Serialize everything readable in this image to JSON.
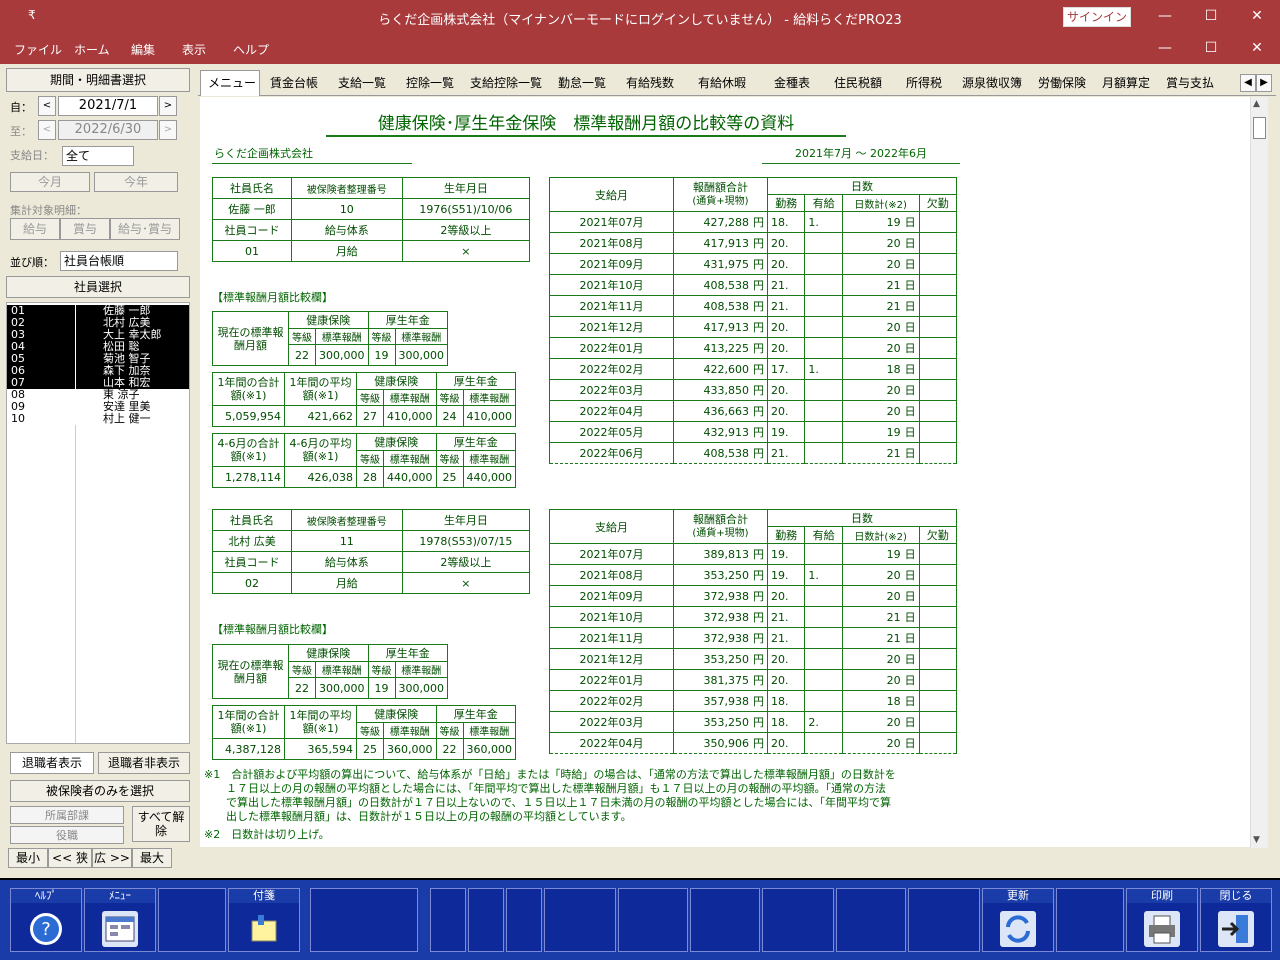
{
  "window": {
    "title": "らくだ企画株式会社（マイナンバーモードにログインしていません） - 給料らくだPRO23",
    "signin": "サインイン",
    "min": "—",
    "max": "☐",
    "close": "✕"
  },
  "menu": [
    "ファイル",
    "ホーム",
    "編集",
    "表示",
    "ヘルプ"
  ],
  "left": {
    "period_btn": "期間・明細書選択",
    "from_lbl": "自：",
    "from": "2021/7/1",
    "to_lbl": "至：",
    "to": "2022/6/30",
    "paydate_lbl": "支給日：",
    "paydate": "全て",
    "this_month": "今月",
    "this_year": "今年",
    "target_lbl": "集計対象明細：",
    "t1": "給与",
    "t2": "賞与",
    "t3": "給与･賞与",
    "sort_lbl": "並び順：",
    "sort": "社員台帳順",
    "emp_sel": "社員選択",
    "employees": [
      {
        "code": "01",
        "name": "佐藤 一郎"
      },
      {
        "code": "02",
        "name": "北村 広美"
      },
      {
        "code": "03",
        "name": "大上 幸太郎"
      },
      {
        "code": "04",
        "name": "松田 聡"
      },
      {
        "code": "05",
        "name": "菊池 智子"
      },
      {
        "code": "06",
        "name": "森下 加奈"
      },
      {
        "code": "07",
        "name": "山本 和宏"
      },
      {
        "code": "08",
        "name": "東 涼子"
      },
      {
        "code": "09",
        "name": "安達 里美"
      },
      {
        "code": "10",
        "name": "村上 健一"
      }
    ],
    "retired_show": "退職者表示",
    "retired_hide": "退職者非表示",
    "insured_only": "被保険者のみを選択",
    "dept": "所属部課",
    "role": "役職",
    "clear_all": "すべて解除",
    "min": "最小",
    "narrow": "<< 狭",
    "wide": "広 >>",
    "max": "最大"
  },
  "tabs": [
    "メニュー",
    "賃金台帳",
    "支給一覧",
    "控除一覧",
    "支給控除一覧",
    "勤怠一覧",
    "有給残数",
    "有給休暇",
    "金種表",
    "住民税額",
    "所得税",
    "源泉徴収簿",
    "労働保険",
    "月額算定",
    "賞与支払"
  ],
  "doc": {
    "title": "健康保険･厚生年金保険　標準報酬月額の比較等の資料",
    "company": "らくだ企画株式会社",
    "period": "2021年7月 〜 2022年6月",
    "hdr": {
      "name": "社員氏名",
      "insno": "被保険者整理番号",
      "birth": "生年月日",
      "code": "社員コード",
      "paytype": "給与体系",
      "grade2": "2等級以上",
      "section": "【標準報酬月額比較欄】",
      "current": "現在の標準報酬月額",
      "health": "健康保険",
      "pension": "厚生年金",
      "grade": "等級",
      "std": "標準報酬",
      "year_total": "1年間の合計額(※1)",
      "year_avg": "1年間の平均額(※1)",
      "q_total": "4-6月の合計額(※1)",
      "q_avg": "4-6月の平均額(※1)",
      "paymonth": "支給月",
      "remun": "報酬額合計",
      "remun2": "(通貨+現物)",
      "days": "日数",
      "work": "勤務",
      "paid": "有給",
      "daysum": "日数計(※2)",
      "absent": "欠勤",
      "yen": "円",
      "day": "日"
    },
    "p1": {
      "name": "佐藤 一郎",
      "insno": "10",
      "birth": "1976(S51)/10/06",
      "code": "01",
      "paytype": "月給",
      "grade2": "×",
      "cur_hg": "22",
      "cur_hs": "300,000",
      "cur_pg": "19",
      "cur_ps": "300,000",
      "yt": "5,059,954",
      "ya": "421,662",
      "y_hg": "27",
      "y_hs": "410,000",
      "y_pg": "24",
      "y_ps": "410,000",
      "qt": "1,278,114",
      "qa": "426,038",
      "q_hg": "28",
      "q_hs": "440,000",
      "q_pg": "25",
      "q_ps": "440,000",
      "rows": [
        [
          "2021年07月",
          "427,288",
          "18.",
          "1.",
          "19"
        ],
        [
          "2021年08月",
          "417,913",
          "20.",
          "",
          "20"
        ],
        [
          "2021年09月",
          "431,975",
          "20.",
          "",
          "20"
        ],
        [
          "2021年10月",
          "408,538",
          "21.",
          "",
          "21"
        ],
        [
          "2021年11月",
          "408,538",
          "21.",
          "",
          "21"
        ],
        [
          "2021年12月",
          "417,913",
          "20.",
          "",
          "20"
        ],
        [
          "2022年01月",
          "413,225",
          "20.",
          "",
          "20"
        ],
        [
          "2022年02月",
          "422,600",
          "17.",
          "1.",
          "18"
        ],
        [
          "2022年03月",
          "433,850",
          "20.",
          "",
          "20"
        ],
        [
          "2022年04月",
          "436,663",
          "20.",
          "",
          "20"
        ],
        [
          "2022年05月",
          "432,913",
          "19.",
          "",
          "19"
        ],
        [
          "2022年06月",
          "408,538",
          "21.",
          "",
          "21"
        ]
      ]
    },
    "p2": {
      "name": "北村 広美",
      "insno": "11",
      "birth": "1978(S53)/07/15",
      "code": "02",
      "paytype": "月給",
      "grade2": "×",
      "cur_hg": "22",
      "cur_hs": "300,000",
      "cur_pg": "19",
      "cur_ps": "300,000",
      "yt": "4,387,128",
      "ya": "365,594",
      "y_hg": "25",
      "y_hs": "360,000",
      "y_pg": "22",
      "y_ps": "360,000",
      "rows": [
        [
          "2021年07月",
          "389,813",
          "19.",
          "",
          "19"
        ],
        [
          "2021年08月",
          "353,250",
          "19.",
          "1.",
          "20"
        ],
        [
          "2021年09月",
          "372,938",
          "20.",
          "",
          "20"
        ],
        [
          "2021年10月",
          "372,938",
          "21.",
          "",
          "21"
        ],
        [
          "2021年11月",
          "372,938",
          "21.",
          "",
          "21"
        ],
        [
          "2021年12月",
          "353,250",
          "20.",
          "",
          "20"
        ],
        [
          "2022年01月",
          "381,375",
          "20.",
          "",
          "20"
        ],
        [
          "2022年02月",
          "357,938",
          "18.",
          "",
          "18"
        ],
        [
          "2022年03月",
          "353,250",
          "18.",
          "2.",
          "20"
        ],
        [
          "2022年04月",
          "350,906",
          "20.",
          "",
          "20"
        ]
      ]
    },
    "note1": [
      "※1　合計額および平均額の算出について、給与体系が「日給」または「時給」の場合は、「通常の方法で算出した標準報酬月額」の日数計を",
      "　　１７日以上の月の報酬の平均額とした場合には、「年間平均で算出した標準報酬月額」も１７日以上の月の報酬の平均額。「通常の方法",
      "　　で算出した標準報酬月額」の日数計が１７日以上ないので、１５日以上１７日未満の月の報酬の平均額とした場合には、「年間平均で算",
      "　　出した標準報酬月額」は、日数計が１５日以上の月の報酬の平均額としています。"
    ],
    "note2": "※2　日数計は切り上げ。"
  },
  "footer": {
    "help": "ﾍﾙﾌﾟ",
    "menu": "ﾒﾆｭｰ",
    "tag": "付箋",
    "refresh": "更新",
    "print": "印刷",
    "close": "閉じる"
  }
}
